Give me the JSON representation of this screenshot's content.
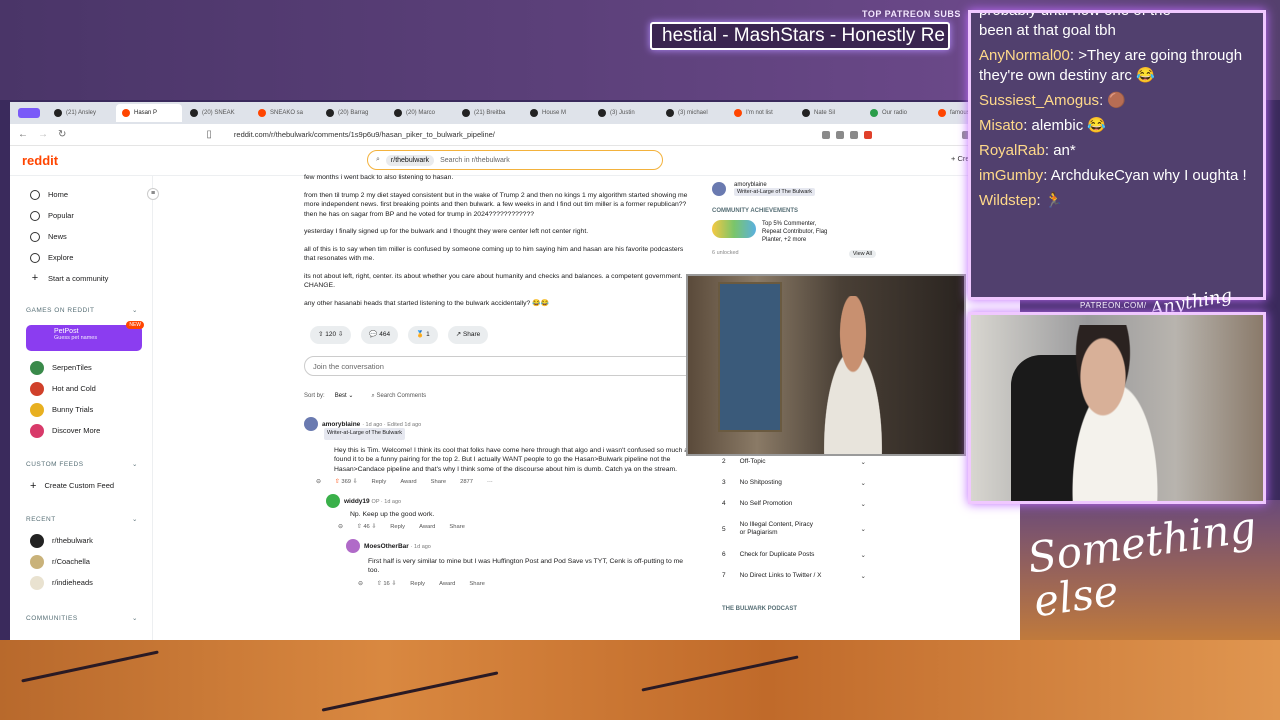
{
  "stream": {
    "ticker_tag": "TOP PATREON SUBS",
    "ticker_text": "hestial - MashStars - Honestly Re",
    "patreon_tag": "PATREON.COM/",
    "brand_small": "Anything",
    "brand_large": "Something else"
  },
  "chat": {
    "lines": [
      {
        "user": "",
        "text": "probably until now one of the"
      },
      {
        "user": "",
        "text": "been at that goal tbh"
      },
      {
        "user": "AnyNormal00",
        "text": ">They are going through they're own destiny arc 😂"
      },
      {
        "user": "Sussiest_Amogus",
        "text": "🟤"
      },
      {
        "user": "Misato",
        "text": "alembic 😂"
      },
      {
        "user": "RoyalRab",
        "text": "an*"
      },
      {
        "user": "imGumby",
        "text": "ArchdukeCyan why I oughta !"
      },
      {
        "user": "Wildstep",
        "text": "🏃"
      }
    ]
  },
  "browser": {
    "tabs": [
      "(21) Ansley",
      "Hasan P",
      "(20) SNEAK",
      "SNEAKO sa",
      "(20) Barrag",
      "(20) Marco",
      "(21) Breitba",
      "House M",
      "(3) Justin",
      "(3) michael",
      "I'm not list",
      "Nate Sil",
      "Our radio",
      "famous"
    ],
    "url": "reddit.com/r/thebulwark/comments/1s9p6u9/hasan_piker_to_bulwark_pipeline/"
  },
  "reddit": {
    "logo": "reddit",
    "search_chip": "r/thebulwark",
    "search_placeholder": "Search in r/thebulwark",
    "create": "Create",
    "nav": [
      "Home",
      "Popular",
      "News",
      "Explore",
      "Start a community"
    ],
    "games_header": "GAMES ON REDDIT",
    "petpost": {
      "title": "PetPost",
      "sub": "Guess pet names",
      "badge": "NEW"
    },
    "games": [
      "SerpenTiles",
      "Hot and Cold",
      "Bunny Trials",
      "Discover More"
    ],
    "custom_feeds_header": "CUSTOM FEEDS",
    "create_custom_feed": "Create Custom Feed",
    "recent_header": "RECENT",
    "recent": [
      "r/thebulwark",
      "r/Coachella",
      "r/indieheads"
    ],
    "communities_header": "COMMUNITIES",
    "post": {
      "p0": "few months i went back to also listening to hasan.",
      "p1": "from then til trump 2 my diet stayed consistent but in the wake of Trump 2 and then no kings 1 my algorithm started showing me more independent news. first breaking points and then bulwark. a few weeks in and I find out tim miller is a former republican?? then he has on sagar from BP and he voted for trump in 2024????????????",
      "p2": "yesterday I finally signed up for the bulwark and I thought they were center left not center right.",
      "p3": "all of this is to say when tim miller is confused by someone coming up to him saying him and hasan are his favorite podcasters that resonates with me.",
      "p4": "its not about left, right, center. its about whether you care about humanity and checks and balances. a competent government. CHANGE.",
      "p5": "any other hasanabi heads that started listening to the bulwark accidentally? 😂😂",
      "votes": "120",
      "comments": "464",
      "awards": "1",
      "share": "Share",
      "join": "Join the conversation",
      "sort_label": "Sort by:",
      "sort_value": "Best",
      "search_comments": "Search Comments"
    },
    "comments": [
      {
        "author": "amoryblaine",
        "meta": "· 1d ago · Edited 1d ago",
        "flair": "Writer-at-Large of The Bulwark",
        "body": "Hey this is Tim. Welcome! I think its cool that folks have come here through that algo and i wasn't confused so much as I found it to be a funny pairing for the top 2. But I actually WANT people to go the Hasan>Bulwark pipeline not the Hasan>Candace pipeline and that's why I think some of the discourse about him is dumb. Catch ya on the stream.",
        "votes": "369",
        "reply": "Reply",
        "award": "Award",
        "share": "Share",
        "extra": "2877"
      },
      {
        "author": "widdy19",
        "meta": "OP · 1d ago",
        "body": "Np. Keep up the good work.",
        "votes": "46",
        "reply": "Reply",
        "award": "Award",
        "share": "Share"
      },
      {
        "author": "MoesOtherBar",
        "meta": "· 1d ago",
        "body": "First half is very similar to mine but I was Huffington Post and Pod Save vs TYT, Cenk is off-putting to me too.",
        "votes": "16",
        "reply": "Reply",
        "award": "Award",
        "share": "Share"
      }
    ],
    "right": {
      "mod_name": "amoryblaine",
      "mod_flair": "Writer-at-Large of The Bulwark",
      "achievements_header": "COMMUNITY ACHIEVEMENTS",
      "achievements_text": "Top 5% Commenter, Repeat Contributor, Flag Planter, +2 more",
      "unlocked": "6 unlocked",
      "view_all": "View All",
      "rules": [
        {
          "n": "2",
          "t": "Off-Topic"
        },
        {
          "n": "3",
          "t": "No Shitposting"
        },
        {
          "n": "4",
          "t": "No Self Promotion"
        },
        {
          "n": "5",
          "t": "No Illegal Content, Piracy or Plagiarism"
        },
        {
          "n": "6",
          "t": "Check for Duplicate Posts"
        },
        {
          "n": "7",
          "t": "No Direct Links to Twitter / X"
        }
      ],
      "podcast_header": "THE BULWARK PODCAST"
    }
  }
}
